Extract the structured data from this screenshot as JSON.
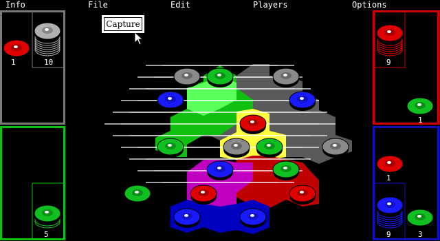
{
  "menu": {
    "info": "Info",
    "file": "File",
    "edit": "Edit",
    "players": "Players",
    "options": "Options"
  },
  "capture_button": "Capture",
  "colors": {
    "red": "#e00000",
    "green": "#10c020",
    "blue": "#0000d0",
    "gray": "#808080",
    "yellow": "#ffff40",
    "magenta": "#c000c0",
    "panel_gray": "#7a7a7a",
    "panel_green": "#10c010",
    "panel_red": "#d00000",
    "panel_blue": "#1010c0"
  },
  "players": {
    "gray": {
      "captured_count": "1",
      "reserve_count": "10"
    },
    "red": {
      "reserve_count": "9",
      "captured_count": "1"
    },
    "green": {
      "reserve_count": "5"
    },
    "blue": {
      "captured_count": "1",
      "reserve_count": "9",
      "captured_green_count": "3"
    }
  }
}
